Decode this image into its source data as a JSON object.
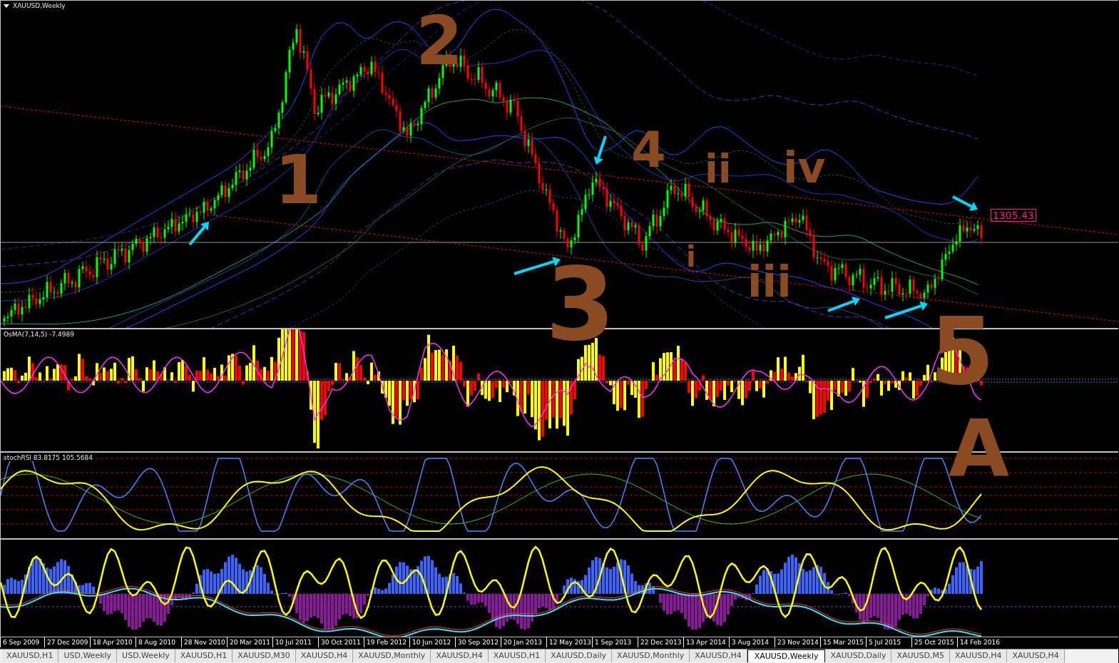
{
  "chart": {
    "title": "XAUUSD,Weekly",
    "price_label": "1305.43",
    "annotations": [
      "2",
      "1",
      "3",
      "4",
      "ii",
      "iv",
      "i",
      "iii",
      "5",
      "A"
    ]
  },
  "osma": {
    "label": "OsMA(7,14,5) -7.4989"
  },
  "stoch_rsi": {
    "label": "stochRSI 83.8175 105.5684"
  },
  "time_axis": [
    "6 Sep 2009",
    "27 Dec 2009",
    "18 Apr 2010",
    "8 Aug 2010",
    "28 Nov 2010",
    "20 Mar 2011",
    "10 Jul 2011",
    "30 Oct 2011",
    "19 Feb 2012",
    "10 Jun 2012",
    "30 Sep 2012",
    "20 Jan 2013",
    "12 May 2013",
    "1 Sep 2013",
    "22 Dec 2013",
    "13 Apr 2014",
    "3 Aug 2014",
    "23 Nov 2014",
    "15 Mar 2015",
    "5 Jul 2015",
    "25 Oct 2015",
    "14 Feb 2016"
  ],
  "tabs": [
    {
      "label": "XAUUSD,H1",
      "selected": false
    },
    {
      "label": "USD,Weekly",
      "selected": false
    },
    {
      "label": "USD,Weekly",
      "selected": false
    },
    {
      "label": "XAUUSD,H1",
      "selected": false
    },
    {
      "label": "XAUUSD,M30",
      "selected": false
    },
    {
      "label": "XAUUSD,H4",
      "selected": false
    },
    {
      "label": "XAUUSD,Monthly",
      "selected": false
    },
    {
      "label": "XAUUSD,H4",
      "selected": false
    },
    {
      "label": "XAUUSD,H1",
      "selected": false
    },
    {
      "label": "XAUUSD,Daily",
      "selected": false
    },
    {
      "label": "XAUUSD,Monthly",
      "selected": false
    },
    {
      "label": "XAUUSD,H4",
      "selected": false
    },
    {
      "label": "XAUUSD,Weekly",
      "selected": true
    },
    {
      "label": "XAUUSD,Daily",
      "selected": false
    },
    {
      "label": "XAUUSD,M5",
      "selected": false
    },
    {
      "label": "XAUUSD,H4",
      "selected": false
    },
    {
      "label": "XAUUSD,H4",
      "selected": false
    }
  ]
}
